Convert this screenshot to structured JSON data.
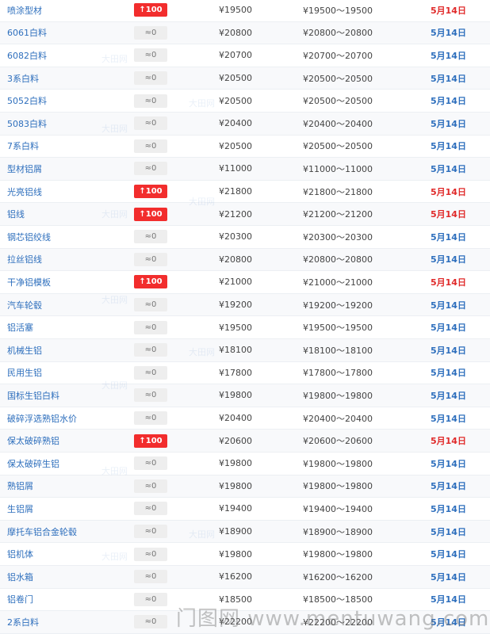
{
  "rows": [
    {
      "name": "喷涂型材",
      "change": "↑100",
      "up": true,
      "price": "¥19500",
      "range": "¥19500～19500",
      "date": "5月14日"
    },
    {
      "name": "6061白料",
      "change": "≈0",
      "up": false,
      "price": "¥20800",
      "range": "¥20800～20800",
      "date": "5月14日"
    },
    {
      "name": "6082白料",
      "change": "≈0",
      "up": false,
      "price": "¥20700",
      "range": "¥20700～20700",
      "date": "5月14日"
    },
    {
      "name": "3系白料",
      "change": "≈0",
      "up": false,
      "price": "¥20500",
      "range": "¥20500～20500",
      "date": "5月14日"
    },
    {
      "name": "5052白料",
      "change": "≈0",
      "up": false,
      "price": "¥20500",
      "range": "¥20500～20500",
      "date": "5月14日"
    },
    {
      "name": "5083白料",
      "change": "≈0",
      "up": false,
      "price": "¥20400",
      "range": "¥20400～20400",
      "date": "5月14日"
    },
    {
      "name": "7系白料",
      "change": "≈0",
      "up": false,
      "price": "¥20500",
      "range": "¥20500～20500",
      "date": "5月14日"
    },
    {
      "name": "型材铝屑",
      "change": "≈0",
      "up": false,
      "price": "¥11000",
      "range": "¥11000～11000",
      "date": "5月14日"
    },
    {
      "name": "光亮铝线",
      "change": "↑100",
      "up": true,
      "price": "¥21800",
      "range": "¥21800～21800",
      "date": "5月14日"
    },
    {
      "name": "铝线",
      "change": "↑100",
      "up": true,
      "price": "¥21200",
      "range": "¥21200～21200",
      "date": "5月14日"
    },
    {
      "name": "钢芯铝绞线",
      "change": "≈0",
      "up": false,
      "price": "¥20300",
      "range": "¥20300～20300",
      "date": "5月14日"
    },
    {
      "name": "拉丝铝线",
      "change": "≈0",
      "up": false,
      "price": "¥20800",
      "range": "¥20800～20800",
      "date": "5月14日"
    },
    {
      "name": "干净铝模板",
      "change": "↑100",
      "up": true,
      "price": "¥21000",
      "range": "¥21000～21000",
      "date": "5月14日"
    },
    {
      "name": "汽车轮毂",
      "change": "≈0",
      "up": false,
      "price": "¥19200",
      "range": "¥19200～19200",
      "date": "5月14日"
    },
    {
      "name": "铝活塞",
      "change": "≈0",
      "up": false,
      "price": "¥19500",
      "range": "¥19500～19500",
      "date": "5月14日"
    },
    {
      "name": "机械生铝",
      "change": "≈0",
      "up": false,
      "price": "¥18100",
      "range": "¥18100～18100",
      "date": "5月14日"
    },
    {
      "name": "民用生铝",
      "change": "≈0",
      "up": false,
      "price": "¥17800",
      "range": "¥17800～17800",
      "date": "5月14日"
    },
    {
      "name": "国标生铝白料",
      "change": "≈0",
      "up": false,
      "price": "¥19800",
      "range": "¥19800～19800",
      "date": "5月14日"
    },
    {
      "name": "破碎浮选熟铝水价",
      "change": "≈0",
      "up": false,
      "price": "¥20400",
      "range": "¥20400～20400",
      "date": "5月14日"
    },
    {
      "name": "保太破碎熟铝",
      "change": "↑100",
      "up": true,
      "price": "¥20600",
      "range": "¥20600～20600",
      "date": "5月14日"
    },
    {
      "name": "保太破碎生铝",
      "change": "≈0",
      "up": false,
      "price": "¥19800",
      "range": "¥19800～19800",
      "date": "5月14日"
    },
    {
      "name": "熟铝屑",
      "change": "≈0",
      "up": false,
      "price": "¥19800",
      "range": "¥19800～19800",
      "date": "5月14日"
    },
    {
      "name": "生铝屑",
      "change": "≈0",
      "up": false,
      "price": "¥19400",
      "range": "¥19400～19400",
      "date": "5月14日"
    },
    {
      "name": "摩托车铝合金轮毂",
      "change": "≈0",
      "up": false,
      "price": "¥18900",
      "range": "¥18900～18900",
      "date": "5月14日"
    },
    {
      "name": "铝机体",
      "change": "≈0",
      "up": false,
      "price": "¥19800",
      "range": "¥19800～19800",
      "date": "5月14日"
    },
    {
      "name": "铝水箱",
      "change": "≈0",
      "up": false,
      "price": "¥16200",
      "range": "¥16200～16200",
      "date": "5月14日"
    },
    {
      "name": "铝卷门",
      "change": "≈0",
      "up": false,
      "price": "¥18500",
      "range": "¥18500～18500",
      "date": "5月14日"
    },
    {
      "name": "2系白料",
      "change": "≈0",
      "up": false,
      "price": "¥22200",
      "range": "¥22200～22200",
      "date": "5月14日"
    }
  ],
  "watermark": {
    "site_text": "门图网 www.mentuwang.com",
    "inline_text": "大田网"
  },
  "colors": {
    "link_blue": "#2e6fbd",
    "up_red": "#f22d2d",
    "neutral_badge": "#eeeeee"
  }
}
